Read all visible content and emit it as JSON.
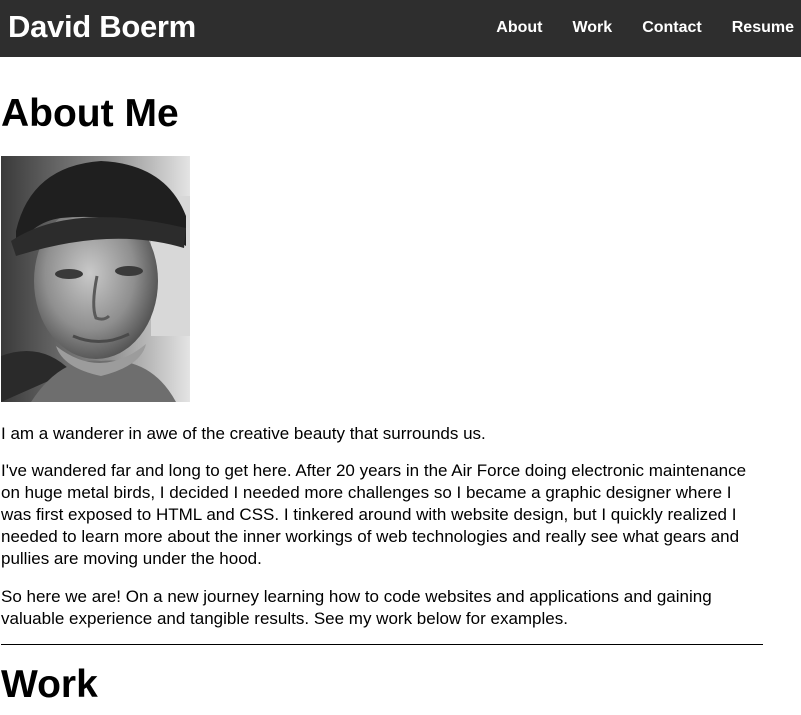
{
  "header": {
    "brand": "David Boerm",
    "nav": [
      {
        "label": "About"
      },
      {
        "label": "Work"
      },
      {
        "label": "Contact"
      },
      {
        "label": "Resume"
      }
    ]
  },
  "about": {
    "title": "About Me",
    "paragraphs": [
      "I am a wanderer in awe of the creative beauty that surrounds us.",
      "I've wandered far and long to get here. After 20 years in the Air Force doing electronic maintenance on huge metal birds, I decided I needed more challenges so I became a graphic designer where I was first exposed to HTML and CSS. I tinkered around with website design, but I quickly realized I needed to learn more about the inner workings of web technologies and really see what gears and pullies are moving under the hood.",
      "So here we are! On a new journey learning how to code websites and applications and gaining valuable experience and tangible results. See my work below for examples."
    ]
  },
  "work": {
    "title": "Work"
  },
  "colors": {
    "nav_background": "#2e2e2e",
    "nav_text": "#ffffff",
    "body_text": "#000000"
  }
}
